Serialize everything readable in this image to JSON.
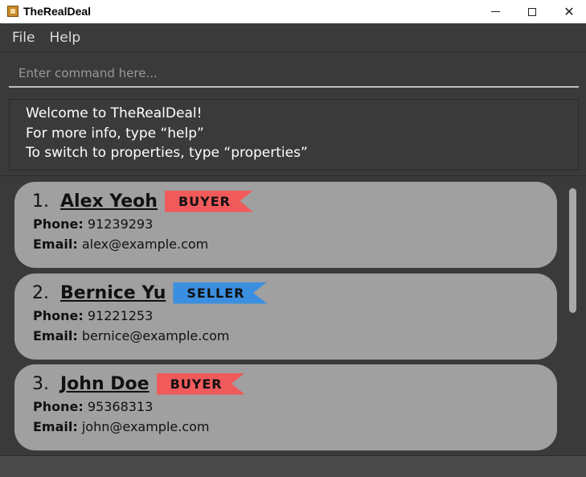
{
  "window": {
    "title": "TheRealDeal",
    "minimize": "minimize",
    "maximize": "maximize",
    "close": "✕"
  },
  "menu": {
    "items": [
      "File",
      "Help"
    ]
  },
  "command": {
    "placeholder": "Enter command here...",
    "value": ""
  },
  "result": {
    "lines": [
      "Welcome to TheRealDeal!",
      "For more info, type “help”",
      "To switch to properties, type “properties”"
    ]
  },
  "people": [
    {
      "index": "1.",
      "name": "Alex Yeoh",
      "tag": "BUYER",
      "phone_label": "Phone:",
      "phone": "91239293",
      "email_label": "Email:",
      "email": "alex@example.com"
    },
    {
      "index": "2.",
      "name": "Bernice Yu",
      "tag": "SELLER",
      "phone_label": "Phone:",
      "phone": "91221253",
      "email_label": "Email:",
      "email": "bernice@example.com"
    },
    {
      "index": "3.",
      "name": "John Doe",
      "tag": "BUYER",
      "phone_label": "Phone:",
      "phone": "95368313",
      "email_label": "Email:",
      "email": "john@example.com"
    }
  ],
  "colors": {
    "buyer_tag": "#f05a5a",
    "seller_tag": "#3b8fe0",
    "card_bg": "#a0a0a0",
    "app_bg": "#3a3a3a"
  }
}
